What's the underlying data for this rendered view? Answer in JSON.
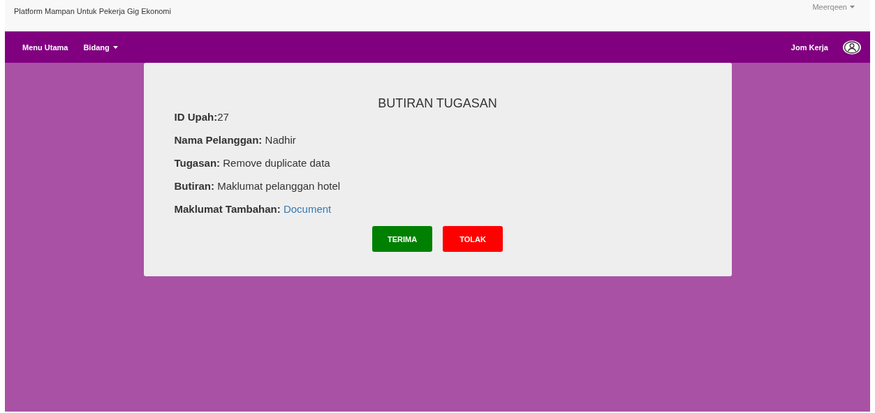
{
  "header": {
    "title": "Platform Mampan Untuk Pekerja Gig Ekonomi",
    "user_menu": "Meerqeen"
  },
  "navbar": {
    "items": [
      {
        "label": "Menu Utama",
        "dropdown": false
      },
      {
        "label": "Bidang",
        "dropdown": true
      }
    ],
    "right_link": "Jom Kerja"
  },
  "card": {
    "title": "BUTIRAN TUGASAN",
    "details": [
      {
        "kind": "text",
        "text": "**ID Upah:**27"
      },
      {
        "kind": "text",
        "text": "**Nama Pelanggan:** Nadhir"
      },
      {
        "kind": "text",
        "text": "**Tugasan:** Remove duplicate data"
      },
      {
        "kind": "text",
        "text": "**Butiran:** Maklumat pelanggan hotel"
      },
      {
        "kind": "link",
        "text": "Maklumat Tambahan:",
        "link": "Document"
      }
    ],
    "buttons": [
      {
        "label": "TERIMA",
        "kind": "accept"
      },
      {
        "label": "TOLAK",
        "kind": "reject"
      }
    ]
  }
}
